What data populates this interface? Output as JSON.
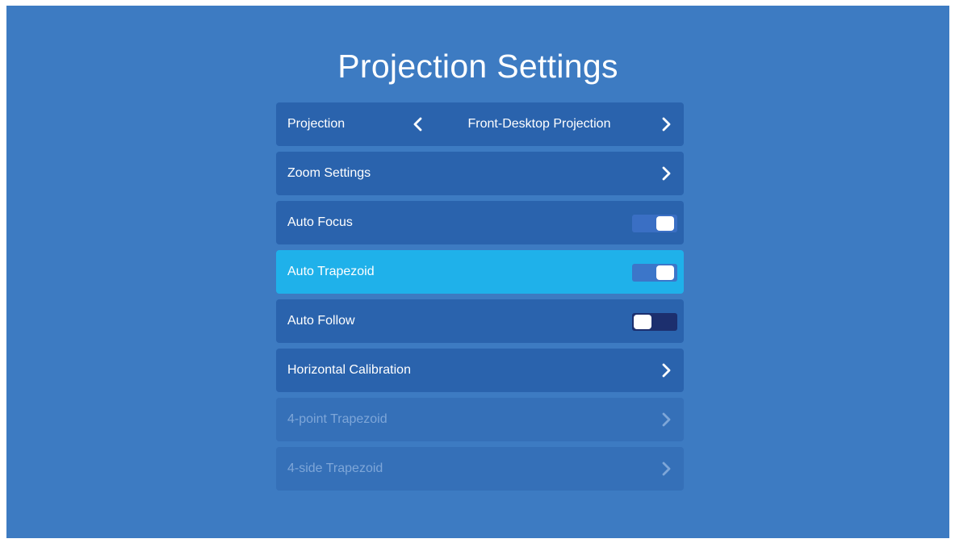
{
  "title": "Projection Settings",
  "menu": [
    {
      "label": "Projection",
      "type": "selector",
      "value": "Front-Desktop Projection"
    },
    {
      "label": "Zoom Settings",
      "type": "link"
    },
    {
      "label": "Auto Focus",
      "type": "toggle",
      "state": "on"
    },
    {
      "label": "Auto Trapezoid",
      "type": "toggle",
      "state": "on",
      "focused": true
    },
    {
      "label": "Auto Follow",
      "type": "toggle",
      "state": "off"
    },
    {
      "label": "Horizontal Calibration",
      "type": "link"
    },
    {
      "label": "4-point Trapezoid",
      "type": "link",
      "disabled": true
    },
    {
      "label": "4-side Trapezoid",
      "type": "link",
      "disabled": true
    }
  ],
  "colors": {
    "background": "#3d7bc2",
    "row": "#2a63ad",
    "row_focused": "#1fb1ea",
    "row_disabled": "#3570b8",
    "text_disabled": "#7ea6d8",
    "toggle_on_track": "#3a6fc4",
    "toggle_off_track": "#1c2f6e"
  },
  "icons": {
    "chevron_left": "chevron-left-icon",
    "chevron_right": "chevron-right-icon"
  }
}
